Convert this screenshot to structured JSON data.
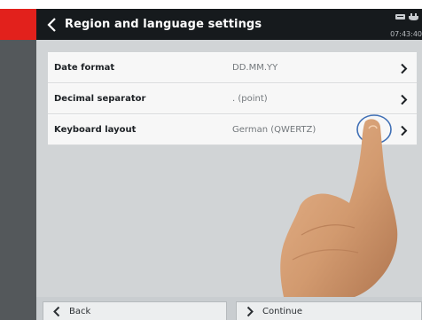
{
  "header": {
    "title": "Region and language settings",
    "clock": "07:43:40"
  },
  "settings": [
    {
      "label": "Date format",
      "value": "DD.MM.YY"
    },
    {
      "label": "Decimal separator",
      "value": ". (point)"
    },
    {
      "label": "Keyboard layout",
      "value": "German (QWERTZ)"
    }
  ],
  "footer": {
    "back_label": "Back",
    "continue_label": "Continue"
  },
  "colors": {
    "accent_red": "#e2211c",
    "header_bg": "#161a1d",
    "highlight_circle": "#3f6fb5"
  },
  "icons": [
    "back-chevron-icon",
    "keyboard-icon",
    "power-plug-icon",
    "chevron-right-icon",
    "chevron-left-icon"
  ]
}
